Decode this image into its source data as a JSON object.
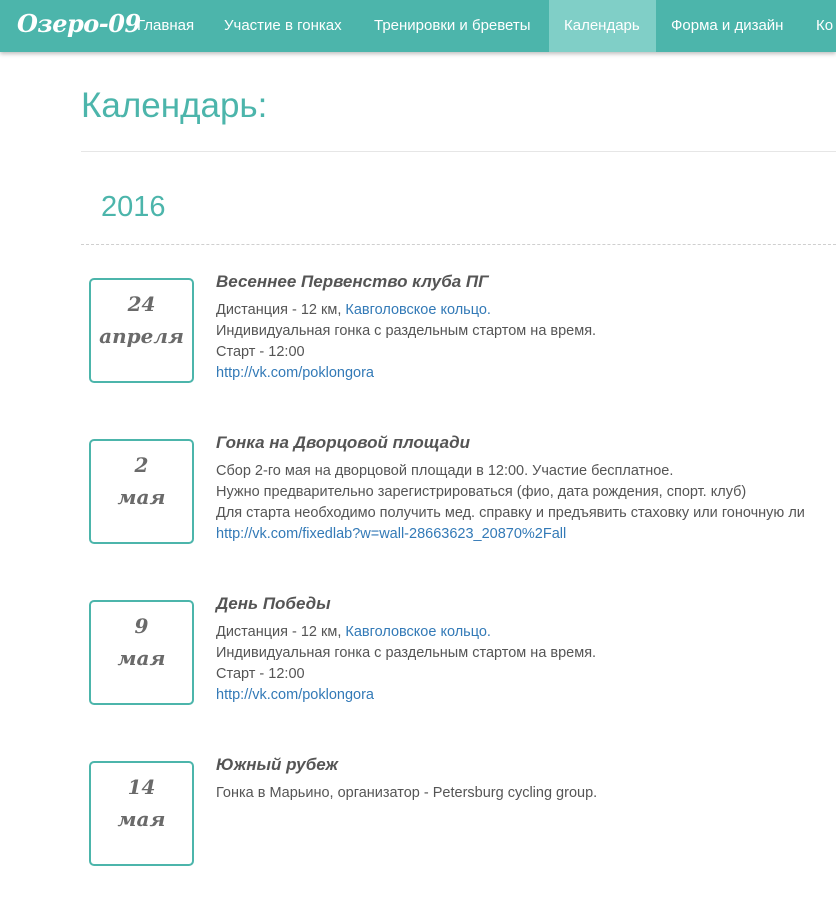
{
  "nav": {
    "brand": "Озеро-09",
    "items": [
      "Главная",
      "Участие в гонках",
      "Тренировки и бреветы",
      "Календарь",
      "Форма и дизайн",
      "Ко"
    ],
    "active_index": 3
  },
  "page": {
    "title": "Календарь:",
    "year": "2016"
  },
  "colors": {
    "accent": "#4cb5ab",
    "nav_active": "#80cfc7",
    "link": "#337ab7",
    "text": "#555555"
  },
  "events": [
    {
      "day": "24",
      "month": "апреля",
      "title": "Весеннее Первенство клуба ПГ",
      "line1_prefix": "Дистанция - 12 км, ",
      "line1_link": "Кавголовское кольцо.",
      "line2": "Индивидуальная гонка с раздельным стартом на время.",
      "line3": "Старт - 12:00",
      "url": "http://vk.com/poklongora"
    },
    {
      "day": "2",
      "month": "мая",
      "title": "Гонка на Дворцовой площади",
      "line1": "Сбор 2-го мая на дворцовой площади в 12:00. Участие бесплатное.",
      "line2": "Нужно предварительно зарегистрироваться (фио, дата рождения, спорт. клуб)",
      "line3": "Для старта необходимо получить мед. справку и предъявить стаховку или гоночную ли",
      "url": "http://vk.com/fixedlab?w=wall-28663623_20870%2Fall"
    },
    {
      "day": "9",
      "month": "мая",
      "title": "День Победы",
      "line1_prefix": "Дистанция - 12 км, ",
      "line1_link": "Кавголовское кольцо.",
      "line2": "Индивидуальная гонка с раздельным стартом на время.",
      "line3": "Старт - 12:00",
      "url": "http://vk.com/poklongora"
    },
    {
      "day": "14",
      "month": "мая",
      "title": "Южный рубеж",
      "line1": "Гонка в Марьино, организатор - Petersburg cycling group."
    }
  ]
}
